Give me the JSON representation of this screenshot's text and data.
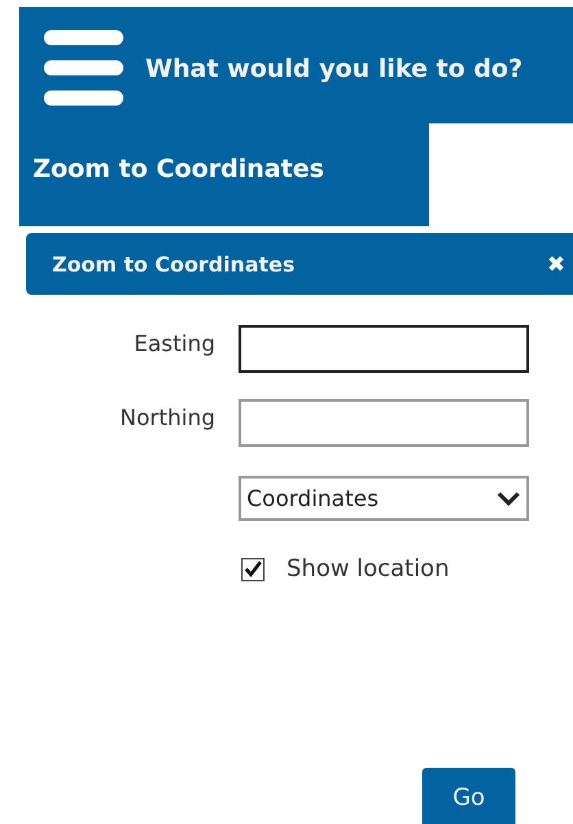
{
  "header": {
    "title": "What would you like to do?"
  },
  "section": {
    "title": "Zoom to Coordinates"
  },
  "panel": {
    "title": "Zoom to Coordinates",
    "close": "✖"
  },
  "fields": [
    {
      "label": "Easting",
      "focused": true
    },
    {
      "label": "Northing",
      "focused": false
    }
  ],
  "select": {
    "value": "Coordinates"
  },
  "checkbox": {
    "label": "Show location",
    "checked": true
  },
  "button": {
    "label": "Go"
  }
}
